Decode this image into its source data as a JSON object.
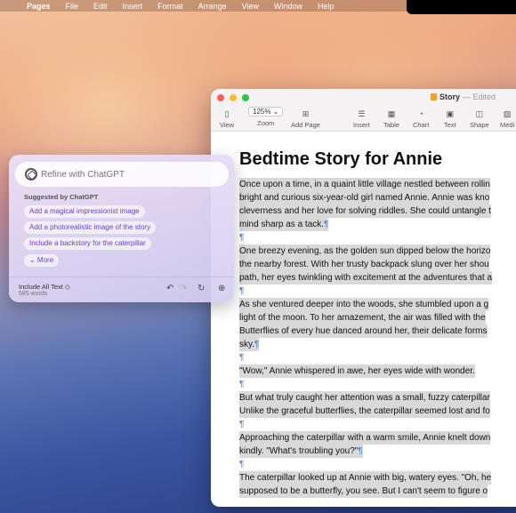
{
  "menubar": {
    "app": "Pages",
    "items": [
      "File",
      "Edit",
      "Insert",
      "Format",
      "Arrange",
      "View",
      "Window",
      "Help"
    ]
  },
  "window": {
    "title": "Story",
    "status": "— Edited",
    "toolbar": {
      "view": "View",
      "zoom_value": "125% ⌄",
      "zoom": "Zoom",
      "add_page": "Add Page",
      "insert": "Insert",
      "table": "Table",
      "chart": "Chart",
      "text": "Text",
      "shape": "Shape",
      "media": "Medi"
    }
  },
  "document": {
    "heading": "Bedtime Story for Annie",
    "paragraphs": [
      [
        "Once upon a time, in a quaint little village nestled between rollin",
        "bright and curious six-year-old girl named Annie. Annie was kno",
        "cleverness and her love for solving riddles. She could untangle t",
        "mind sharp as a tack."
      ],
      [
        "One breezy evening, as the golden sun dipped below the horizo",
        "the nearby forest. With her trusty backpack slung over her shou",
        "path, her eyes twinkling with excitement at the adventures that a"
      ],
      [
        "As she ventured deeper into the woods, she stumbled upon a g",
        "light of the moon. To her amazement, the air was filled with the",
        "Butterflies of every hue danced around her, their delicate forms",
        "sky."
      ],
      [
        "\"Wow,\" Annie whispered in awe, her eyes wide with wonder."
      ],
      [
        "But what truly caught her attention was a small, fuzzy caterpillar",
        "Unlike the graceful butterflies, the caterpillar seemed lost and fo"
      ],
      [
        "Approaching the caterpillar with a warm smile, Annie knelt down",
        "kindly. \"What's troubling you?\""
      ],
      [
        "The caterpillar looked up at Annie with big, watery eyes. \"Oh, he",
        "supposed to be a butterfly, you see. But I can't seem to figure o"
      ]
    ],
    "pilcrow": "¶"
  },
  "chatgpt": {
    "placeholder": "Refine with ChatGPT",
    "suggested_title": "Suggested by ChatGPT",
    "suggestions": [
      "Add a magical impressionist image",
      "Add a photorealistic image of the story",
      "Include a backstory for the caterpillar"
    ],
    "more": "⌄ More",
    "include": "Include All Text ◇",
    "word_count": "585 words"
  }
}
